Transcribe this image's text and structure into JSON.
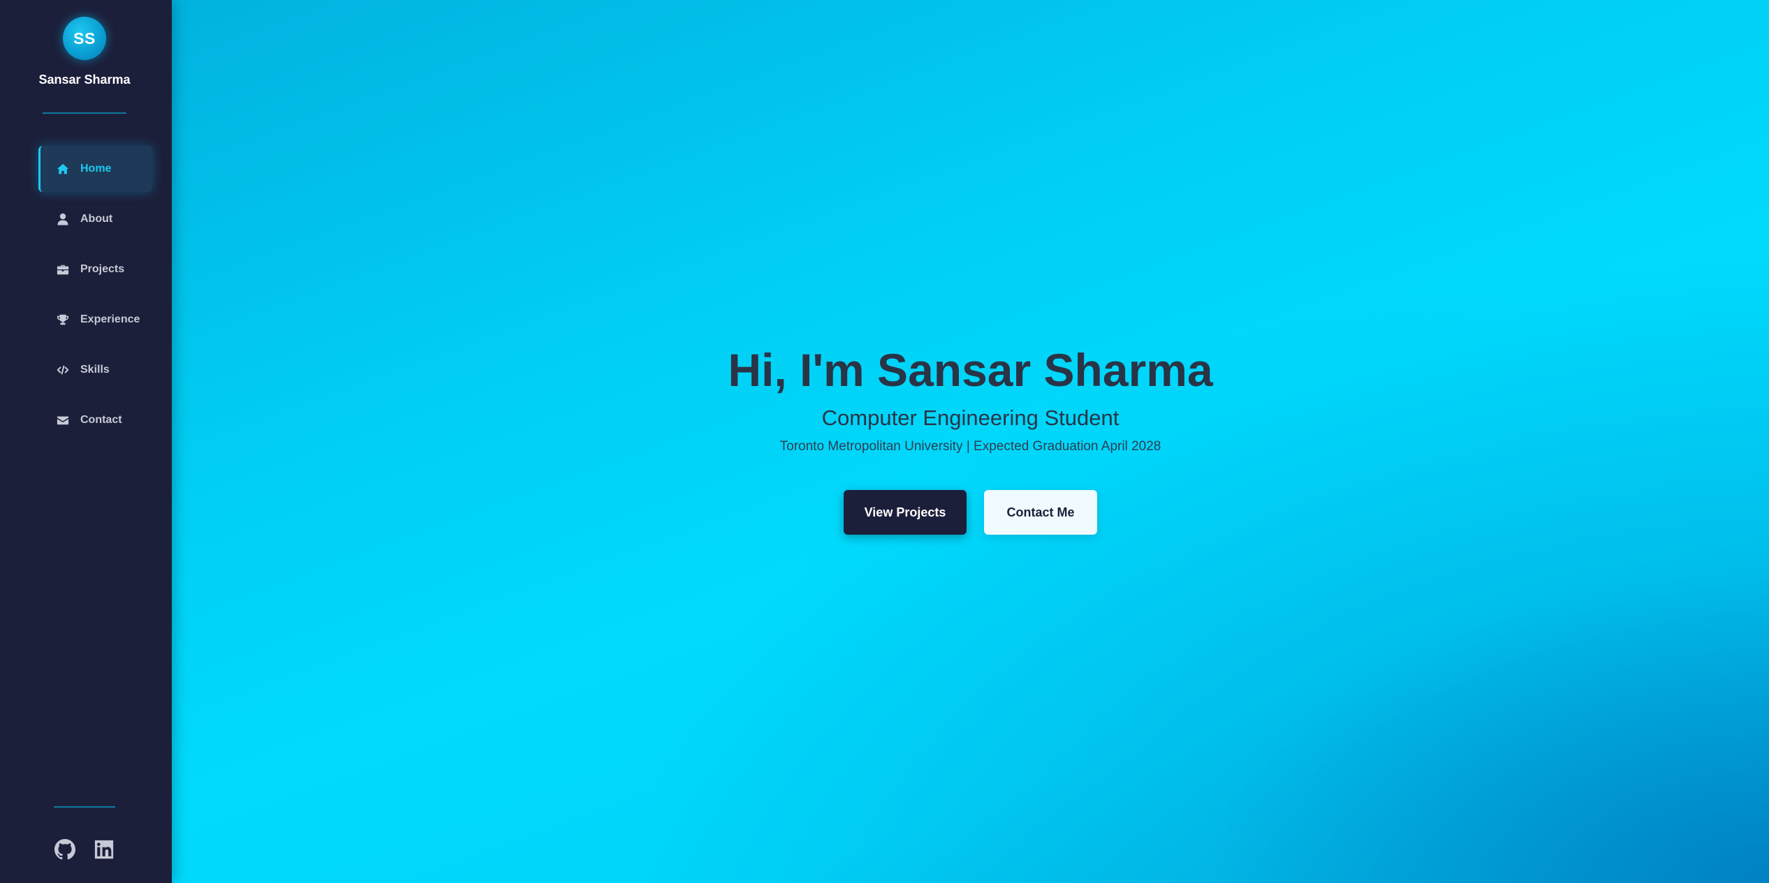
{
  "profile": {
    "initials": "SS",
    "name": "Sansar Sharma"
  },
  "nav": {
    "items": [
      {
        "label": "Home",
        "icon": "home-icon",
        "active": true
      },
      {
        "label": "About",
        "icon": "user-icon",
        "active": false
      },
      {
        "label": "Projects",
        "icon": "briefcase-icon",
        "active": false
      },
      {
        "label": "Experience",
        "icon": "trophy-icon",
        "active": false
      },
      {
        "label": "Skills",
        "icon": "code-icon",
        "active": false
      },
      {
        "label": "Contact",
        "icon": "envelope-icon",
        "active": false
      }
    ]
  },
  "social": {
    "links": [
      {
        "icon": "github-icon"
      },
      {
        "icon": "linkedin-icon"
      }
    ]
  },
  "hero": {
    "title": "Hi, I'm Sansar Sharma",
    "subtitle": "Computer Engineering Student",
    "meta": "Toronto Metropolitan University | Expected Graduation April 2028",
    "primary_button": "View Projects",
    "secondary_button": "Contact Me"
  },
  "colors": {
    "sidebar_bg": "#1c1f3a",
    "accent": "#1ec8f0",
    "main_bg": "#00d4f9",
    "text_dark": "#2a3447"
  }
}
